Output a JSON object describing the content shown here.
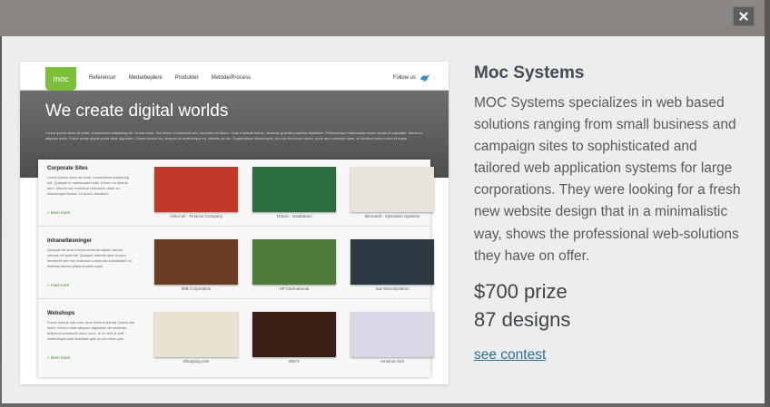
{
  "modal": {
    "close_symbol": "×",
    "title": "Moc Systems",
    "description": "MOC Systems specializes in web based solutions ranging from small business and campaign sites to sophisticated and tailored web application systems for large corporations. They were looking for a fresh new website design that in a minimalistic way, shows the professional web-solutions they have on offer.",
    "prize": "$700 prize",
    "designs": "87 designs",
    "cta": "see contest"
  },
  "mockup": {
    "logo": "moc",
    "nav": [
      "Referencer",
      "Medarbejdere",
      "Produkter",
      "Metode/Process"
    ],
    "follow": "Follow us",
    "hero_title": "We create digital worlds",
    "hero_text": "Lorem ipsum dolor sit amet, consectetur adipiscing elit. In sed enim. Sed libero et euismod sed, hendrerit eu libero. Cras a blandit lectus. Vivamus gravida pharetra dignissim. Pellentesque malesuada ornare turpis et vulputate. Morbi eu aliquam dolor. Fusce porta aliquet porta vitae dignissim. Donec lectus leo, tempus ac scelerisque eu, lobortis ac dui. Suspendisse ullamcorper, dui non tincidunt rutrum, nunc arcu vehicula diam, at tincidunt enim lorem et turpis.",
    "sections": [
      {
        "title": "Corporate Sites",
        "text": "Lorem ipsum dolor sit amet, consectetur adipiscing elit. Quisque in malesuada nulla. Donec eu dictum sem. Mauris non euismod commodo dolor eu ullamcorper lectus. Ut at dui, tincidunt",
        "more": "» learn more",
        "thumbs": [
          {
            "caption": "Acko.net - Finance Company",
            "color": "#c0392b"
          },
          {
            "caption": "Oracle - Databases",
            "color": "#2c6e3f"
          },
          {
            "caption": "Microsoft - Operation Systems",
            "color": "#e8e4dc"
          }
        ]
      },
      {
        "title": "Intranetløsninger",
        "text": "Quisque sit amet metus vehicula sapien iaculis ultrices vel quis elit. Quisque lobortis sem at arcu hendrerit sed non euismod commodo dolorlacinia mi eleifend lacinia placerat pelle sque.",
        "more": "» read more",
        "thumbs": [
          {
            "caption": "IMB Corporation",
            "color": "#6b3b22"
          },
          {
            "caption": "HP International",
            "color": "#4f7c3a"
          },
          {
            "caption": "Sun Microsystems",
            "color": "#2d3a44"
          }
        ]
      },
      {
        "title": "Webshops",
        "text": "Fusce cursus odio non risus viverra blandit. Donec ips dolor, viverra vitae aliquam dignissim sit ametorto euismod commodo dolor nunc. In at velit ut velit scelerisque bore tincidunt quis ut orci vetch pen.",
        "more": "» learn more",
        "thumbs": [
          {
            "caption": "Shopping.com",
            "color": "#e9e2d2"
          },
          {
            "caption": "EBAY",
            "color": "#3a1f16"
          },
          {
            "caption": "Amazon.com",
            "color": "#d9d8e6"
          }
        ]
      }
    ]
  },
  "colors": {
    "modal_bg": "#eceded",
    "title": "#454b53",
    "link": "#2f6f93",
    "logo_green": "#7cbf3a"
  }
}
